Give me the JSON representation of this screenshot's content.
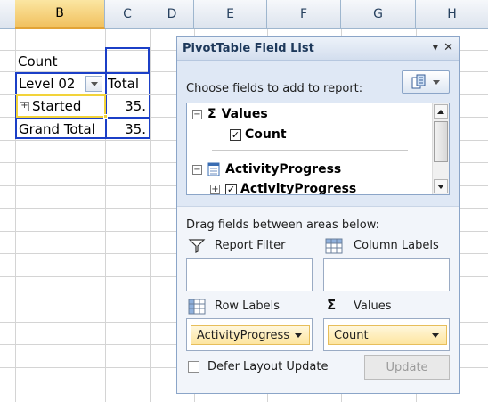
{
  "columns": [
    "B",
    "C",
    "D",
    "E",
    "F",
    "G",
    "H"
  ],
  "pivot": {
    "values_caption": "Count",
    "row_header": "Level 02",
    "col_header": "Total",
    "row_item": "Started",
    "row_item_value": "35.",
    "grand_total_label": "Grand Total",
    "grand_total_value": "35."
  },
  "pane": {
    "title": "PivotTable Field List",
    "close_glyph": "✕",
    "menu_glyph": "▾",
    "choose_label": "Choose fields to add to report:",
    "fields": {
      "values_group": "Values",
      "values_field": "Count",
      "table_name": "ActivityProgress",
      "table_field": "ActivityProgress"
    },
    "drag_label": "Drag fields between areas below:",
    "areas": {
      "report_filter": "Report Filter",
      "column_labels": "Column Labels",
      "row_labels": "Row Labels",
      "values": "Values"
    },
    "row_labels_item": "ActivityProgress",
    "values_item": "Count",
    "defer_label": "Defer Layout Update",
    "update_button": "Update"
  },
  "icons": {
    "expand": "+",
    "collapse": "−",
    "check": "✓",
    "sigma": "Σ"
  },
  "colors": {
    "selection_border": "#1b3fc7",
    "active_cell": "#f2d33a",
    "pane_background": "#dfe8f5"
  }
}
